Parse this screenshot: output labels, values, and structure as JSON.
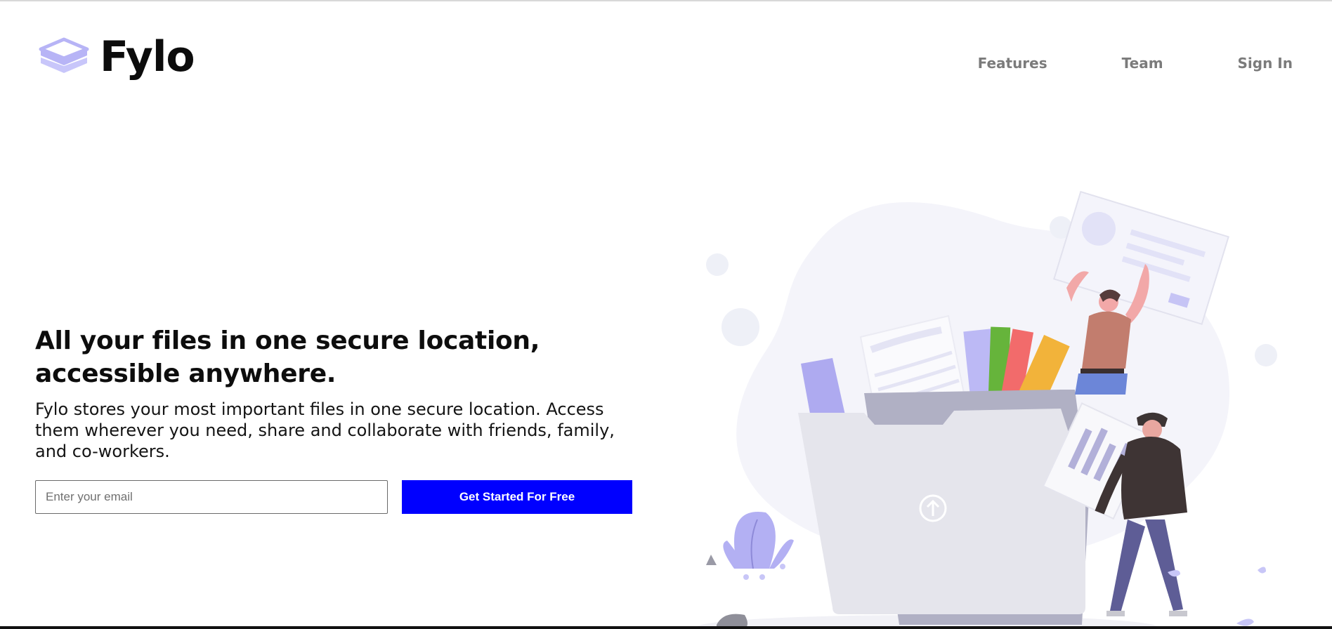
{
  "header": {
    "brand": "Fylo",
    "nav": [
      {
        "label": "Features"
      },
      {
        "label": "Team"
      },
      {
        "label": "Sign In"
      }
    ]
  },
  "hero": {
    "title_line1": "All your files in one secure location,",
    "title_line2": "accessible anywhere.",
    "description": "Fylo stores your most important files in one secure location. Access them wherever you need, share and collaborate with friends, family, and co-workers.",
    "email_placeholder": "Enter your email",
    "email_value": "",
    "cta_label": "Get Started For Free"
  },
  "icons": {
    "logo": "stacked-layers-icon",
    "upload": "upload-arrow-icon"
  },
  "colors": {
    "cta_background": "#0000ff",
    "cta_text": "#ffffff",
    "logo_accent": "#b8b6f5",
    "nav_text": "#7b7b7b",
    "heading_text": "#0d0d0d"
  }
}
